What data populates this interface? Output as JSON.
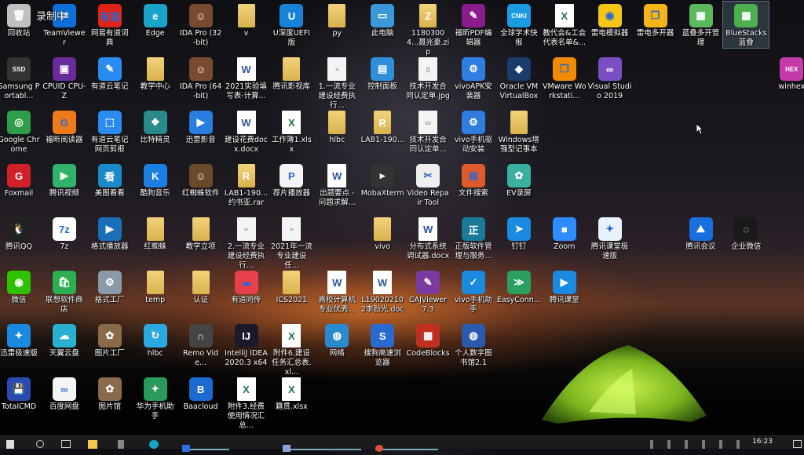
{
  "overlay_text": "录制中",
  "rows": [
    [
      {
        "label": "回收站",
        "icon": "recycle-bin-icon",
        "color": "#c0c0c0",
        "glyph": "🗑"
      },
      {
        "label": "TeamViewer",
        "icon": "teamviewer-icon",
        "color": "#0e6fd8",
        "glyph": "⇄"
      },
      {
        "label": "网易有道词典",
        "icon": "youdao-dict-icon",
        "color": "#e2231a",
        "glyph": "有道"
      },
      {
        "label": "Edge",
        "icon": "edge-icon",
        "color": "#1aa3c8",
        "glyph": "e"
      },
      {
        "label": "IDA Pro (32-bit)",
        "icon": "ida-pro-icon",
        "color": "#7a4a30",
        "glyph": "☺"
      },
      {
        "label": "v",
        "icon": "folder-icon",
        "type": "folder"
      },
      {
        "label": "U深度UEFI版",
        "icon": "usb-icon",
        "color": "#1683d8",
        "glyph": "U"
      },
      {
        "label": "py",
        "icon": "folder-icon",
        "type": "folder"
      },
      {
        "label": "此电脑",
        "icon": "computer-icon",
        "color": "#3a9ad9",
        "glyph": "▭"
      },
      {
        "label": "11803004...聂兆豪.zip",
        "icon": "zip-icon",
        "type": "folder",
        "glyph": "Z"
      },
      {
        "label": "福昕PDF编辑器",
        "icon": "foxit-pdf-icon",
        "color": "#8a1c8c",
        "glyph": "✎"
      },
      {
        "label": "全球学术快报",
        "icon": "cnki-icon",
        "color": "#1a9ae0",
        "glyph": "CNKI"
      },
      {
        "label": "教代会&工会代表名单&...",
        "icon": "excel-icon",
        "type": "xls",
        "glyph": "X"
      },
      {
        "label": "雷电模拟器",
        "icon": "ldplayer-icon",
        "color": "#f5c518",
        "glyph": "◉"
      },
      {
        "label": "雷电多开器",
        "icon": "ldmulti-icon",
        "color": "#f5b518",
        "glyph": "❐"
      },
      {
        "label": "蓝叠多开管理",
        "icon": "bluestacks-multi-icon",
        "color": "#5cb85c",
        "glyph": "▦"
      },
      {
        "label": "BlueStacks蓝叠",
        "icon": "bluestacks-icon",
        "color": "#4caf50",
        "glyph": "▦",
        "selected": true
      },
      null
    ],
    [
      {
        "label": "Samsung Portabl...",
        "icon": "samsung-ssd-icon",
        "color": "#333",
        "glyph": "SSD"
      },
      {
        "label": "CPUID CPU-Z",
        "icon": "cpuz-icon",
        "color": "#6a2b9a",
        "glyph": "▣"
      },
      {
        "label": "有道云笔记",
        "icon": "youdao-note-icon",
        "color": "#2a8cf0",
        "glyph": "✎"
      },
      {
        "label": "教学中心",
        "icon": "folder-icon",
        "type": "folder"
      },
      {
        "label": "IDA Pro (64-bit)",
        "icon": "ida-pro-icon",
        "color": "#7a4a30",
        "glyph": "☺"
      },
      {
        "label": "2021实验填写表-计算...",
        "icon": "word-icon",
        "type": "doc",
        "glyph": "W"
      },
      {
        "label": "腾讯影视库",
        "icon": "folder-icon",
        "type": "folder"
      },
      {
        "label": "1.一流专业建设经费执行...",
        "icon": "document-icon",
        "type": "file",
        "glyph": "≡"
      },
      {
        "label": "控制面板",
        "icon": "control-panel-icon",
        "color": "#2f8fd8",
        "glyph": "▤"
      },
      {
        "label": "技术开发合同认定单.jpg",
        "icon": "image-file-icon",
        "type": "file",
        "glyph": "▯"
      },
      {
        "label": "vivoAPK安装器",
        "icon": "vivo-apk-icon",
        "color": "#2f7de0",
        "glyph": "⚙"
      },
      {
        "label": "Oracle VM VirtualBox",
        "icon": "virtualbox-icon",
        "color": "#1b3c6b",
        "glyph": "◆"
      },
      {
        "label": "VMware Workstati...",
        "icon": "vmware-icon",
        "color": "#f08a00",
        "glyph": "❐"
      },
      {
        "label": "Visual Studio 2019",
        "icon": "visual-studio-icon",
        "color": "#7b4fc4",
        "glyph": "∞"
      },
      null,
      null,
      null,
      {
        "label": "winhex",
        "icon": "winhex-icon",
        "color": "#c43aa8",
        "glyph": "HEX"
      }
    ],
    [
      {
        "label": "Google Chrome",
        "icon": "chrome-icon",
        "color": "#2e9e48",
        "glyph": "◎"
      },
      {
        "label": "福昕阅读器",
        "icon": "foxit-reader-icon",
        "color": "#f07a1a",
        "glyph": "G"
      },
      {
        "label": "有道云笔记网页剪报",
        "icon": "youdao-clip-icon",
        "color": "#2a8cf0",
        "glyph": "⬚"
      },
      {
        "label": "比特精灵",
        "icon": "bitcomet-icon",
        "color": "#2a8a8a",
        "glyph": "❖"
      },
      {
        "label": "迅雷影音",
        "icon": "xunlei-player-icon",
        "color": "#2a7de0",
        "glyph": "▶"
      },
      {
        "label": "建设花费docx.docx",
        "icon": "word-icon",
        "type": "doc",
        "glyph": "W"
      },
      {
        "label": "工作簿1.xlsx",
        "icon": "excel-icon",
        "type": "xls",
        "glyph": "X"
      },
      {
        "label": "hlbc",
        "icon": "folder-user-icon",
        "type": "folder"
      },
      {
        "label": "LAB1-190...",
        "icon": "rar-icon",
        "type": "folder",
        "glyph": "R"
      },
      {
        "label": "技术开发合同认定单...",
        "icon": "image-file-icon",
        "type": "file",
        "glyph": "▭"
      },
      {
        "label": "vivo手机驱动安装",
        "icon": "vivo-driver-icon",
        "color": "#2f7de0",
        "glyph": "⚙"
      },
      {
        "label": "Windows增强型记事本",
        "icon": "folder-icon",
        "type": "folder"
      }
    ],
    [
      {
        "label": "Foxmail",
        "icon": "foxmail-icon",
        "color": "#d0202a",
        "glyph": "G"
      },
      {
        "label": "腾讯视频",
        "icon": "tencent-video-icon",
        "color": "#2fb36a",
        "glyph": "▶"
      },
      {
        "label": "美图看看",
        "icon": "meitu-icon",
        "color": "#1a8ac8",
        "glyph": "看"
      },
      {
        "label": "酷狗音乐",
        "icon": "kugou-icon",
        "color": "#1a7fe0",
        "glyph": "K"
      },
      {
        "label": "红蜘蛛软件",
        "icon": "red-spider-icon",
        "color": "#6b4a2a",
        "glyph": "☺"
      },
      {
        "label": "LAB1-190...约书亚.rar",
        "icon": "rar-icon",
        "type": "folder",
        "glyph": "R"
      },
      {
        "label": "荐片播放器",
        "icon": "jianpian-icon",
        "color": "#f4f4f4",
        "glyph": "P"
      },
      {
        "label": "出题要点 - 问题求解...",
        "icon": "word-icon",
        "type": "doc",
        "glyph": "W"
      },
      {
        "label": "MobaXterm",
        "icon": "mobaxterm-icon",
        "color": "#333",
        "glyph": "▸"
      },
      {
        "label": "Video Repair Tool",
        "icon": "video-repair-icon",
        "color": "#eee",
        "glyph": "✂"
      },
      {
        "label": "文件搜索",
        "icon": "file-search-icon",
        "color": "#e05a2a",
        "glyph": "▤"
      },
      {
        "label": "EV录屏",
        "icon": "ev-recorder-icon",
        "color": "#3ab0a0",
        "glyph": "✿"
      }
    ],
    [
      {
        "label": "腾讯QQ",
        "icon": "qq-icon",
        "color": "#222",
        "glyph": "🐧"
      },
      {
        "label": "7z",
        "icon": "7zip-icon",
        "color": "#fff",
        "glyph": "7z"
      },
      {
        "label": "格式播放器",
        "icon": "format-player-icon",
        "color": "#1a6fb8",
        "glyph": "▶"
      },
      {
        "label": "红蜘蛛",
        "icon": "folder-icon",
        "type": "folder"
      },
      {
        "label": "教学立项",
        "icon": "folder-icon",
        "type": "folder"
      },
      {
        "label": "2.一流专业建设经费执行...",
        "icon": "document-icon",
        "type": "file",
        "glyph": "≡"
      },
      {
        "label": "2021年一流专业建设任...",
        "icon": "document-icon",
        "type": "file",
        "glyph": "≡"
      },
      null,
      {
        "label": "vivo",
        "icon": "folder-icon",
        "type": "folder"
      },
      {
        "label": "分布式系统调试器.docx",
        "icon": "word-icon",
        "type": "doc",
        "glyph": "W"
      },
      {
        "label": "正版软件管理与服务...",
        "icon": "software-mgmt-icon",
        "color": "#1a7a9a",
        "glyph": "正"
      },
      {
        "label": "钉钉",
        "icon": "dingtalk-icon",
        "color": "#1a8ae0",
        "glyph": "➤"
      },
      {
        "label": "Zoom",
        "icon": "zoom-icon",
        "color": "#2d8cff",
        "glyph": "■"
      },
      {
        "label": "腾讯课堂极速版",
        "icon": "tencent-class-lite-icon",
        "color": "#e8f2fc",
        "glyph": "✦"
      },
      null,
      {
        "label": "腾讯会议",
        "icon": "tencent-meeting-icon",
        "color": "#1a6fe0",
        "glyph": "⛰"
      },
      {
        "label": "企业微信",
        "icon": "wecom-icon",
        "color": "#1a1a1a",
        "glyph": "◌"
      }
    ],
    [
      {
        "label": "微信",
        "icon": "wechat-icon",
        "color": "#2dc100",
        "glyph": "◉"
      },
      {
        "label": "联想软件商店",
        "icon": "lenovo-store-icon",
        "color": "#2ab050",
        "glyph": "🛍"
      },
      {
        "label": "格式工厂",
        "icon": "format-factory-icon",
        "color": "#8a9aa8",
        "glyph": "⚙"
      },
      {
        "label": "temp",
        "icon": "folder-icon",
        "type": "folder"
      },
      {
        "label": "认证",
        "icon": "folder-icon",
        "type": "folder"
      },
      {
        "label": "有道同传",
        "icon": "youdao-interp-icon",
        "color": "#e8404a",
        "glyph": "☁"
      },
      {
        "label": "ICS2021",
        "icon": "folder-icon",
        "type": "folder"
      },
      {
        "label": "高校计算机专业优秀...",
        "icon": "word-icon",
        "type": "doc",
        "glyph": "W"
      },
      {
        "label": "L190202102李劲光.doc",
        "icon": "word-icon",
        "type": "doc",
        "glyph": "W"
      },
      {
        "label": "CAJViewer 7.3",
        "icon": "cajviewer-icon",
        "color": "#7a3aa0",
        "glyph": "✎"
      },
      {
        "label": "vivo手机助手",
        "icon": "vivo-assistant-icon",
        "color": "#1a8ae0",
        "glyph": "✓"
      },
      {
        "label": "EasyConn...",
        "icon": "easyconnect-icon",
        "color": "#2aa060",
        "glyph": "≫"
      },
      {
        "label": "腾讯课堂",
        "icon": "tencent-class-icon",
        "color": "#1a8ae0",
        "glyph": "▶"
      }
    ],
    [
      {
        "label": "迅雷极速版",
        "icon": "xunlei-icon",
        "color": "#1a8ae0",
        "glyph": "✦"
      },
      {
        "label": "天翼云盘",
        "icon": "tianyi-cloud-icon",
        "color": "#2ab0d0",
        "glyph": "☁"
      },
      {
        "label": "图片工厂",
        "icon": "picture-factory-icon",
        "color": "#8a6a4a",
        "glyph": "✿"
      },
      {
        "label": "hlbc",
        "icon": "hlbc-icon",
        "color": "#2aa8e0",
        "glyph": "↻"
      },
      {
        "label": "Remo Vide...",
        "icon": "remo-video-icon",
        "color": "#444",
        "glyph": "∩"
      },
      {
        "label": "IntelliJ IDEA 2020.3 x64",
        "icon": "intellij-icon",
        "color": "#1a1a2a",
        "glyph": "IJ"
      },
      {
        "label": "附件6.建设任务汇总表.xl...",
        "icon": "excel-icon",
        "type": "xls",
        "glyph": "X"
      },
      {
        "label": "网络",
        "icon": "network-icon",
        "color": "#2a8ad0",
        "glyph": "◍"
      },
      {
        "label": "搜狗高速浏览器",
        "icon": "sogou-browser-icon",
        "color": "#2a6ad0",
        "glyph": "S"
      },
      {
        "label": "CodeBlocks",
        "icon": "codeblocks-icon",
        "color": "#c03020",
        "glyph": "▦"
      },
      {
        "label": "个人数字图书馆2.1",
        "icon": "digital-library-icon",
        "color": "#2a5ab0",
        "glyph": "◍"
      }
    ],
    [
      {
        "label": "TotalCMD",
        "icon": "totalcmd-icon",
        "color": "#2a4ab0",
        "glyph": "💾"
      },
      {
        "label": "百度网盘",
        "icon": "baidu-netdisk-icon",
        "color": "#f4f4f4",
        "glyph": "∞"
      },
      {
        "label": "图片馆",
        "icon": "picture-gallery-icon",
        "color": "#8a6a4a",
        "glyph": "✿"
      },
      {
        "label": "华为手机助手",
        "icon": "huawei-assistant-icon",
        "color": "#2a9a5a",
        "glyph": "✦"
      },
      {
        "label": "Baacloud",
        "icon": "baacloud-icon",
        "color": "#1a6ad0",
        "glyph": "B"
      },
      {
        "label": "附件3.经费使用情况汇总...",
        "icon": "excel-icon",
        "type": "xls",
        "glyph": "X"
      },
      {
        "label": "籍贯.xlsx",
        "icon": "excel-icon",
        "type": "xls",
        "glyph": "X"
      }
    ]
  ],
  "taskbar": {
    "time": "16:23"
  }
}
